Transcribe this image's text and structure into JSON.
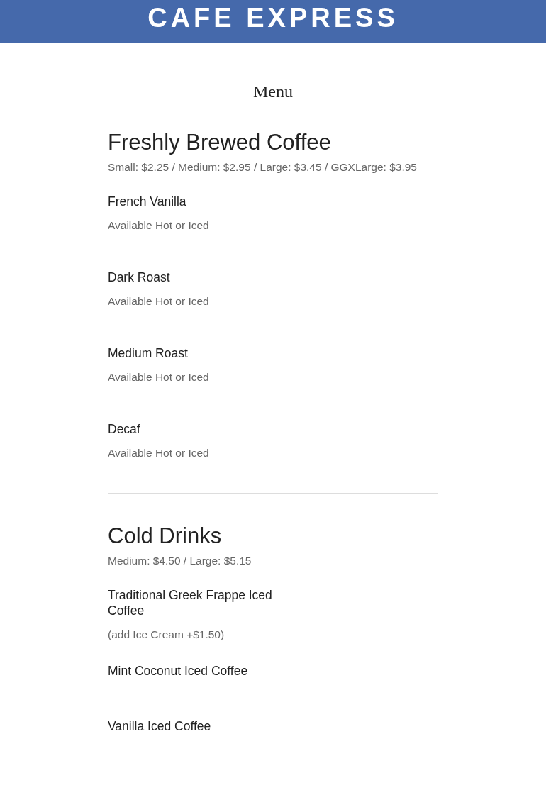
{
  "header": {
    "title": "CAFE EXPRESS"
  },
  "page_title": "Menu",
  "sections": [
    {
      "title": "Freshly Brewed Coffee",
      "prices": "Small: $2.25 / Medium: $2.95 / Large: $3.45 / GGXLarge: $3.95",
      "items": [
        {
          "name": "French Vanilla",
          "note": "Available Hot or Iced"
        },
        {
          "name": "Dark Roast",
          "note": "Available Hot or Iced"
        },
        {
          "name": "Medium Roast",
          "note": "Available Hot or Iced"
        },
        {
          "name": "Decaf",
          "note": "Available Hot or Iced"
        }
      ]
    },
    {
      "title": "Cold Drinks",
      "prices": "Medium: $4.50 / Large: $5.15",
      "items": [
        {
          "name": "Traditional Greek Frappe Iced Coffee",
          "note": "(add Ice Cream +$1.50)"
        },
        {
          "name": "Mint Coconut Iced Coffee"
        },
        {
          "name": "Vanilla Iced Coffee"
        }
      ]
    }
  ]
}
